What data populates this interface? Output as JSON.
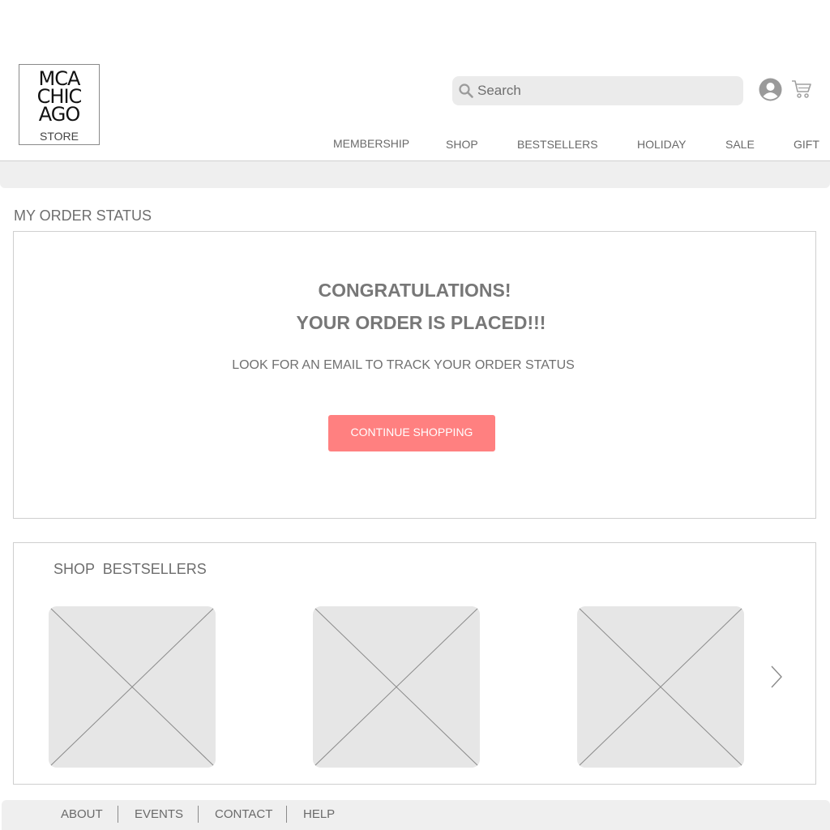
{
  "brand": {
    "logo_lines": [
      "MCA",
      "CHIC",
      "AGO"
    ],
    "logo_store": "STORE"
  },
  "header": {
    "search_placeholder": "Search",
    "icons": [
      "search-icon",
      "account-icon",
      "cart-icon"
    ]
  },
  "nav": {
    "items": [
      "MEMBERSHIP",
      "SHOP",
      "BESTSELLERS",
      "HOLIDAY",
      "SALE",
      "GIFT"
    ]
  },
  "order": {
    "section_title": "MY ORDER STATUS",
    "headline": "CONGRATULATIONS!",
    "subheadline": "YOUR ORDER IS PLACED!!!",
    "note": "LOOK FOR AN EMAIL TO TRACK YOUR ORDER STATUS",
    "button_label": "CONTINUE SHOPPING"
  },
  "bestsellers": {
    "title": "SHOP  BESTSELLERS",
    "next_icon": "chevron-right-icon"
  },
  "footer": {
    "links": [
      "ABOUT",
      "EVENTS",
      "CONTACT",
      "HELP"
    ]
  },
  "colors": {
    "accent": "#ff8080",
    "panel_border": "#cfcfcf",
    "bar_bg": "#efefef",
    "placeholder_bg": "#e6e6e6",
    "text": "#777777"
  }
}
